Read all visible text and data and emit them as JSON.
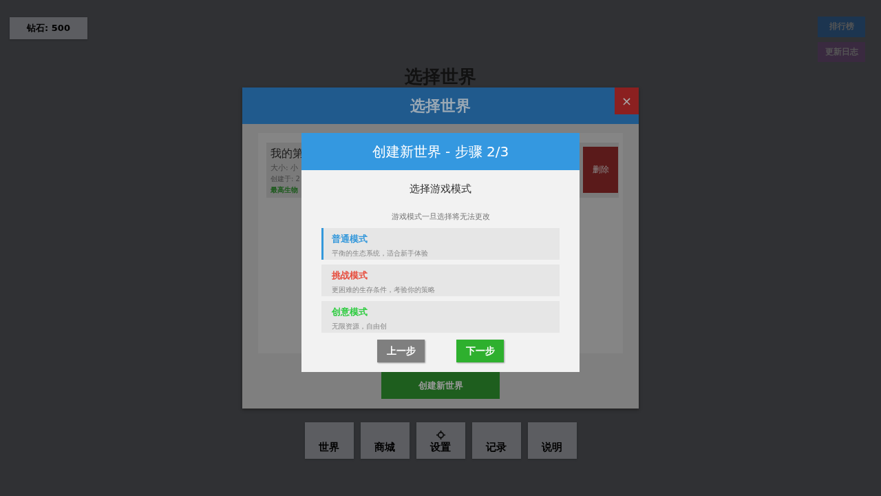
{
  "diamonds": "钻石: 500",
  "top_buttons": [
    {
      "label": "排行榜",
      "color": "#1c3550"
    },
    {
      "label": "更新日志",
      "color": "#3a2a40"
    }
  ],
  "page_title": "选择世界",
  "nav": [
    {
      "label": "世界",
      "kind": "text"
    },
    {
      "label": "商城",
      "kind": "text"
    },
    {
      "label": "设置",
      "kind": "gear"
    },
    {
      "label": "记录",
      "kind": "text"
    },
    {
      "label": "说明",
      "kind": "text"
    }
  ],
  "world_dialog": {
    "title": "选择世界",
    "close": "×",
    "worlds": [
      {
        "name": "我的第",
        "size": "大小: 小",
        "created": "创建于: 2",
        "top": "最高生物",
        "delete": "删除"
      }
    ],
    "create_button": "创建新世界"
  },
  "create_dialog": {
    "title": "创建新世界 - 步骤 2/3",
    "heading": "选择游戏模式",
    "hint": "游戏模式一旦选择将无法更改",
    "modes": [
      {
        "name": "普通模式",
        "desc": "平衡的生态系统，适合新手体验",
        "color": "#3498db",
        "selected": true
      },
      {
        "name": "挑战模式",
        "desc": "更困难的生存条件，考验你的策略",
        "color": "#e74c3c",
        "selected": false
      },
      {
        "name": "创意模式",
        "desc": "无限资源，自由创",
        "color": "#2ecc40",
        "selected": false
      }
    ],
    "back": "上一步",
    "next": "下一步"
  }
}
